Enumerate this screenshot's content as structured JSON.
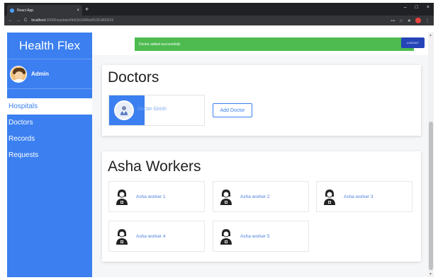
{
  "browser": {
    "tab_title": "React App",
    "tab_close": "×",
    "new_tab": "+",
    "window_controls": [
      "–",
      "□",
      "×"
    ],
    "nav": [
      "←",
      "→",
      "C"
    ],
    "url_host": "localhost",
    "url_path": ":3000/hospitals/6b62b2d96bd91351800015",
    "ext_icons": [
      "⊶",
      "☆",
      "★",
      "⋮"
    ]
  },
  "sidebar": {
    "brand": "Health Flex",
    "user_name": "Admin",
    "items": [
      {
        "label": "Hospitals",
        "active": true
      },
      {
        "label": "Doctors",
        "active": false
      },
      {
        "label": "Records",
        "active": false
      },
      {
        "label": "Requests",
        "active": false
      }
    ]
  },
  "topbar": {
    "toast": "Doctor added successfully",
    "logout": "LOGOUT"
  },
  "doctors": {
    "title": "Doctors",
    "items": [
      {
        "name": "Doctor Girish"
      }
    ],
    "add_label": "Add Doctor"
  },
  "asha": {
    "title": "Asha Workers",
    "items": [
      {
        "name": "Asha worker 1"
      },
      {
        "name": "Asha worker 2"
      },
      {
        "name": "Asha worker 3"
      },
      {
        "name": "Asha worker 4"
      },
      {
        "name": "Asha worker 5"
      }
    ]
  },
  "colors": {
    "sidebar": "#3b7ff0",
    "toast": "#4dbb4f",
    "logout": "#2444b8"
  }
}
